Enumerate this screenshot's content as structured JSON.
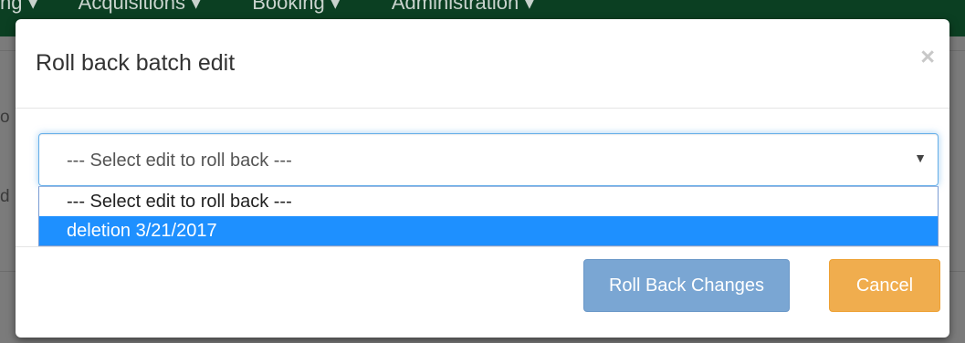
{
  "background": {
    "nav_items": [
      "ng ▾",
      "Acquisitions ▾",
      "Booking ▾",
      "Administration ▾"
    ],
    "fragments": [
      "o",
      "d"
    ]
  },
  "modal": {
    "title": "Roll back batch edit",
    "close_label": "×",
    "select": {
      "current_value": "--- Select edit to roll back ---",
      "arrow": "▼",
      "options": [
        "--- Select edit to roll back ---",
        "deletion 3/21/2017"
      ],
      "highlighted_index": 1
    },
    "buttons": {
      "roll_back_label": "Roll Back Changes",
      "cancel_label": "Cancel"
    }
  },
  "colors": {
    "navbar": "#0b3f22",
    "primary_disabled": "#7aa6d3",
    "warning": "#f0ad4e",
    "option_highlight": "#1e90ff"
  }
}
